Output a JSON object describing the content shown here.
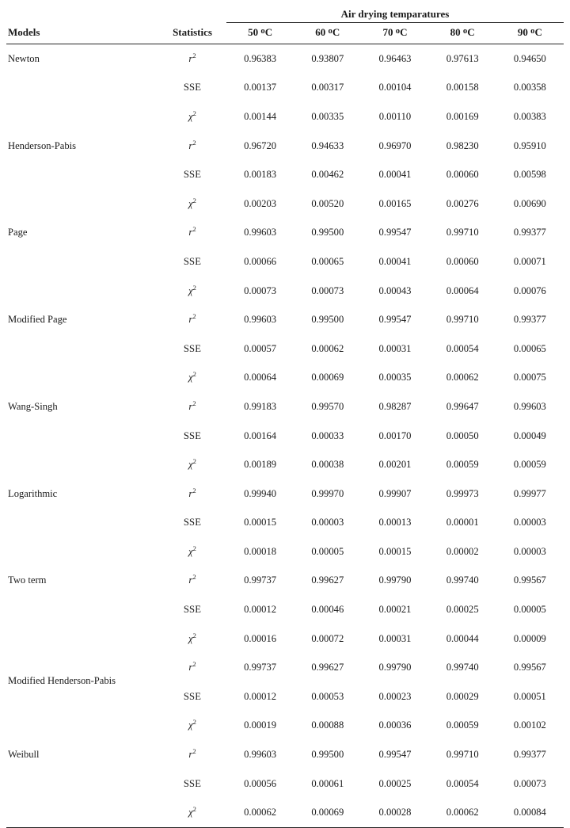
{
  "table": {
    "header": {
      "models_label": "Models",
      "statistics_label": "Statistics",
      "group_label": "Air drying temparatures",
      "temperatures": [
        "50 ºC",
        "60 ºC",
        "70 ºC",
        "80 ºC",
        "90 ºC"
      ]
    },
    "statistic_labels": {
      "r2": "r",
      "r2_sup": "2",
      "sse": "SSE",
      "chi2": "χ",
      "chi2_sup": "2"
    },
    "models": [
      "Newton",
      "Henderson-Pabis",
      "Page",
      "Modified Page",
      "Wang-Singh",
      "Logarithmic",
      "Two term",
      "Modified Henderson-Pabis",
      "Weibull"
    ]
  },
  "chart_data": {
    "type": "table",
    "title": "Air drying temparatures",
    "row_group_label": "Models",
    "statistic_label": "Statistics",
    "categories": [
      "50 ºC",
      "60 ºC",
      "70 ºC",
      "80 ºC",
      "90 ºC"
    ],
    "statistics": [
      "r2",
      "SSE",
      "chi2"
    ],
    "rows": [
      {
        "model": "Newton",
        "r2": [
          "0.96383",
          "0.93807",
          "0.96463",
          "0.97613",
          "0.94650"
        ],
        "SSE": [
          "0.00137",
          "0.00317",
          "0.00104",
          "0.00158",
          "0.00358"
        ],
        "chi2": [
          "0.00144",
          "0.00335",
          "0.00110",
          "0.00169",
          "0.00383"
        ]
      },
      {
        "model": "Henderson-Pabis",
        "r2": [
          "0.96720",
          "0.94633",
          "0.96970",
          "0.98230",
          "0.95910"
        ],
        "SSE": [
          "0.00183",
          "0.00462",
          "0.00041",
          "0.00060",
          "0.00598"
        ],
        "chi2": [
          "0.00203",
          "0.00520",
          "0.00165",
          "0.00276",
          "0.00690"
        ]
      },
      {
        "model": "Page",
        "r2": [
          "0.99603",
          "0.99500",
          "0.99547",
          "0.99710",
          "0.99377"
        ],
        "SSE": [
          "0.00066",
          "0.00065",
          "0.00041",
          "0.00060",
          "0.00071"
        ],
        "chi2": [
          "0.00073",
          "0.00073",
          "0.00043",
          "0.00064",
          "0.00076"
        ]
      },
      {
        "model": "Modified Page",
        "r2": [
          "0.99603",
          "0.99500",
          "0.99547",
          "0.99710",
          "0.99377"
        ],
        "SSE": [
          "0.00057",
          "0.00062",
          "0.00031",
          "0.00054",
          "0.00065"
        ],
        "chi2": [
          "0.00064",
          "0.00069",
          "0.00035",
          "0.00062",
          "0.00075"
        ]
      },
      {
        "model": "Wang-Singh",
        "r2": [
          "0.99183",
          "0.99570",
          "0.98287",
          "0.99647",
          "0.99603"
        ],
        "SSE": [
          "0.00164",
          "0.00033",
          "0.00170",
          "0.00050",
          "0.00049"
        ],
        "chi2": [
          "0.00189",
          "0.00038",
          "0.00201",
          "0.00059",
          "0.00059"
        ]
      },
      {
        "model": "Logarithmic",
        "r2": [
          "0.99940",
          "0.99970",
          "0.99907",
          "0.99973",
          "0.99977"
        ],
        "SSE": [
          "0.00015",
          "0.00003",
          "0.00013",
          "0.00001",
          "0.00003"
        ],
        "chi2": [
          "0.00018",
          "0.00005",
          "0.00015",
          "0.00002",
          "0.00003"
        ]
      },
      {
        "model": "Two term",
        "r2": [
          "0.99737",
          "0.99627",
          "0.99790",
          "0.99740",
          "0.99567"
        ],
        "SSE": [
          "0.00012",
          "0.00046",
          "0.00021",
          "0.00025",
          "0.00005"
        ],
        "chi2": [
          "0.00016",
          "0.00072",
          "0.00031",
          "0.00044",
          "0.00009"
        ]
      },
      {
        "model": "Modified Henderson-Pabis",
        "r2": [
          "0.99737",
          "0.99627",
          "0.99790",
          "0.99740",
          "0.99567"
        ],
        "SSE": [
          "0.00012",
          "0.00053",
          "0.00023",
          "0.00029",
          "0.00051"
        ],
        "chi2": [
          "0.00019",
          "0.00088",
          "0.00036",
          "0.00059",
          "0.00102"
        ]
      },
      {
        "model": "Weibull",
        "r2": [
          "0.99603",
          "0.99500",
          "0.99547",
          "0.99710",
          "0.99377"
        ],
        "SSE": [
          "0.00056",
          "0.00061",
          "0.00025",
          "0.00054",
          "0.00073"
        ],
        "chi2": [
          "0.00062",
          "0.00069",
          "0.00028",
          "0.00062",
          "0.00084"
        ]
      }
    ]
  }
}
